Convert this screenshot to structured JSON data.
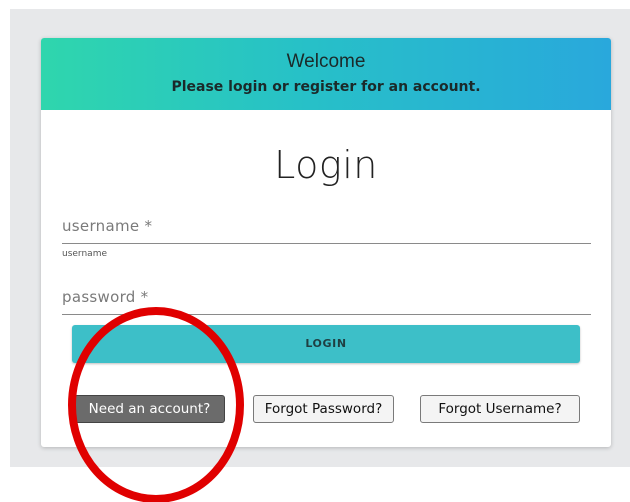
{
  "header": {
    "welcome": "Welcome",
    "subtitle": "Please login or register for an account."
  },
  "page": {
    "title": "Login"
  },
  "form": {
    "username": {
      "label": "username *",
      "helper": "username",
      "value": ""
    },
    "password": {
      "label": "password *",
      "value": ""
    },
    "login_label": "LOGIN"
  },
  "links": {
    "register": "Need an account?",
    "forgot_password": "Forgot Password?",
    "forgot_username": "Forgot Username?"
  },
  "colors": {
    "header_gradient_start": "#2fd6ad",
    "header_gradient_end": "#29a8dc",
    "login_button": "#3dbfc8",
    "register_button": "#6b6b6b",
    "annotation_circle": "#e00000"
  },
  "annotation": {
    "shape": "circle",
    "target": "register-button"
  }
}
